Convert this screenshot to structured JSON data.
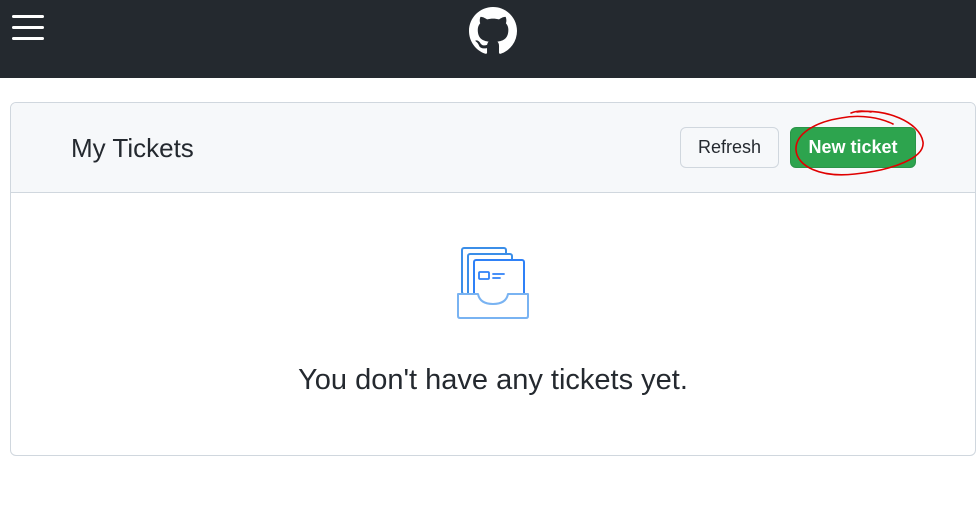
{
  "header": {
    "menu_icon": "hamburger-menu-icon",
    "logo_icon": "github-logo-icon"
  },
  "tickets_panel": {
    "title": "My Tickets",
    "refresh_label": "Refresh",
    "new_ticket_label": "New ticket",
    "empty_state_icon": "tickets-inbox-icon",
    "empty_message": "You don't have any tickets yet."
  },
  "colors": {
    "topbar": "#24292f",
    "primary_button": "#2da44e",
    "annotation": "#e00000",
    "empty_icon": "#2f81f7"
  }
}
